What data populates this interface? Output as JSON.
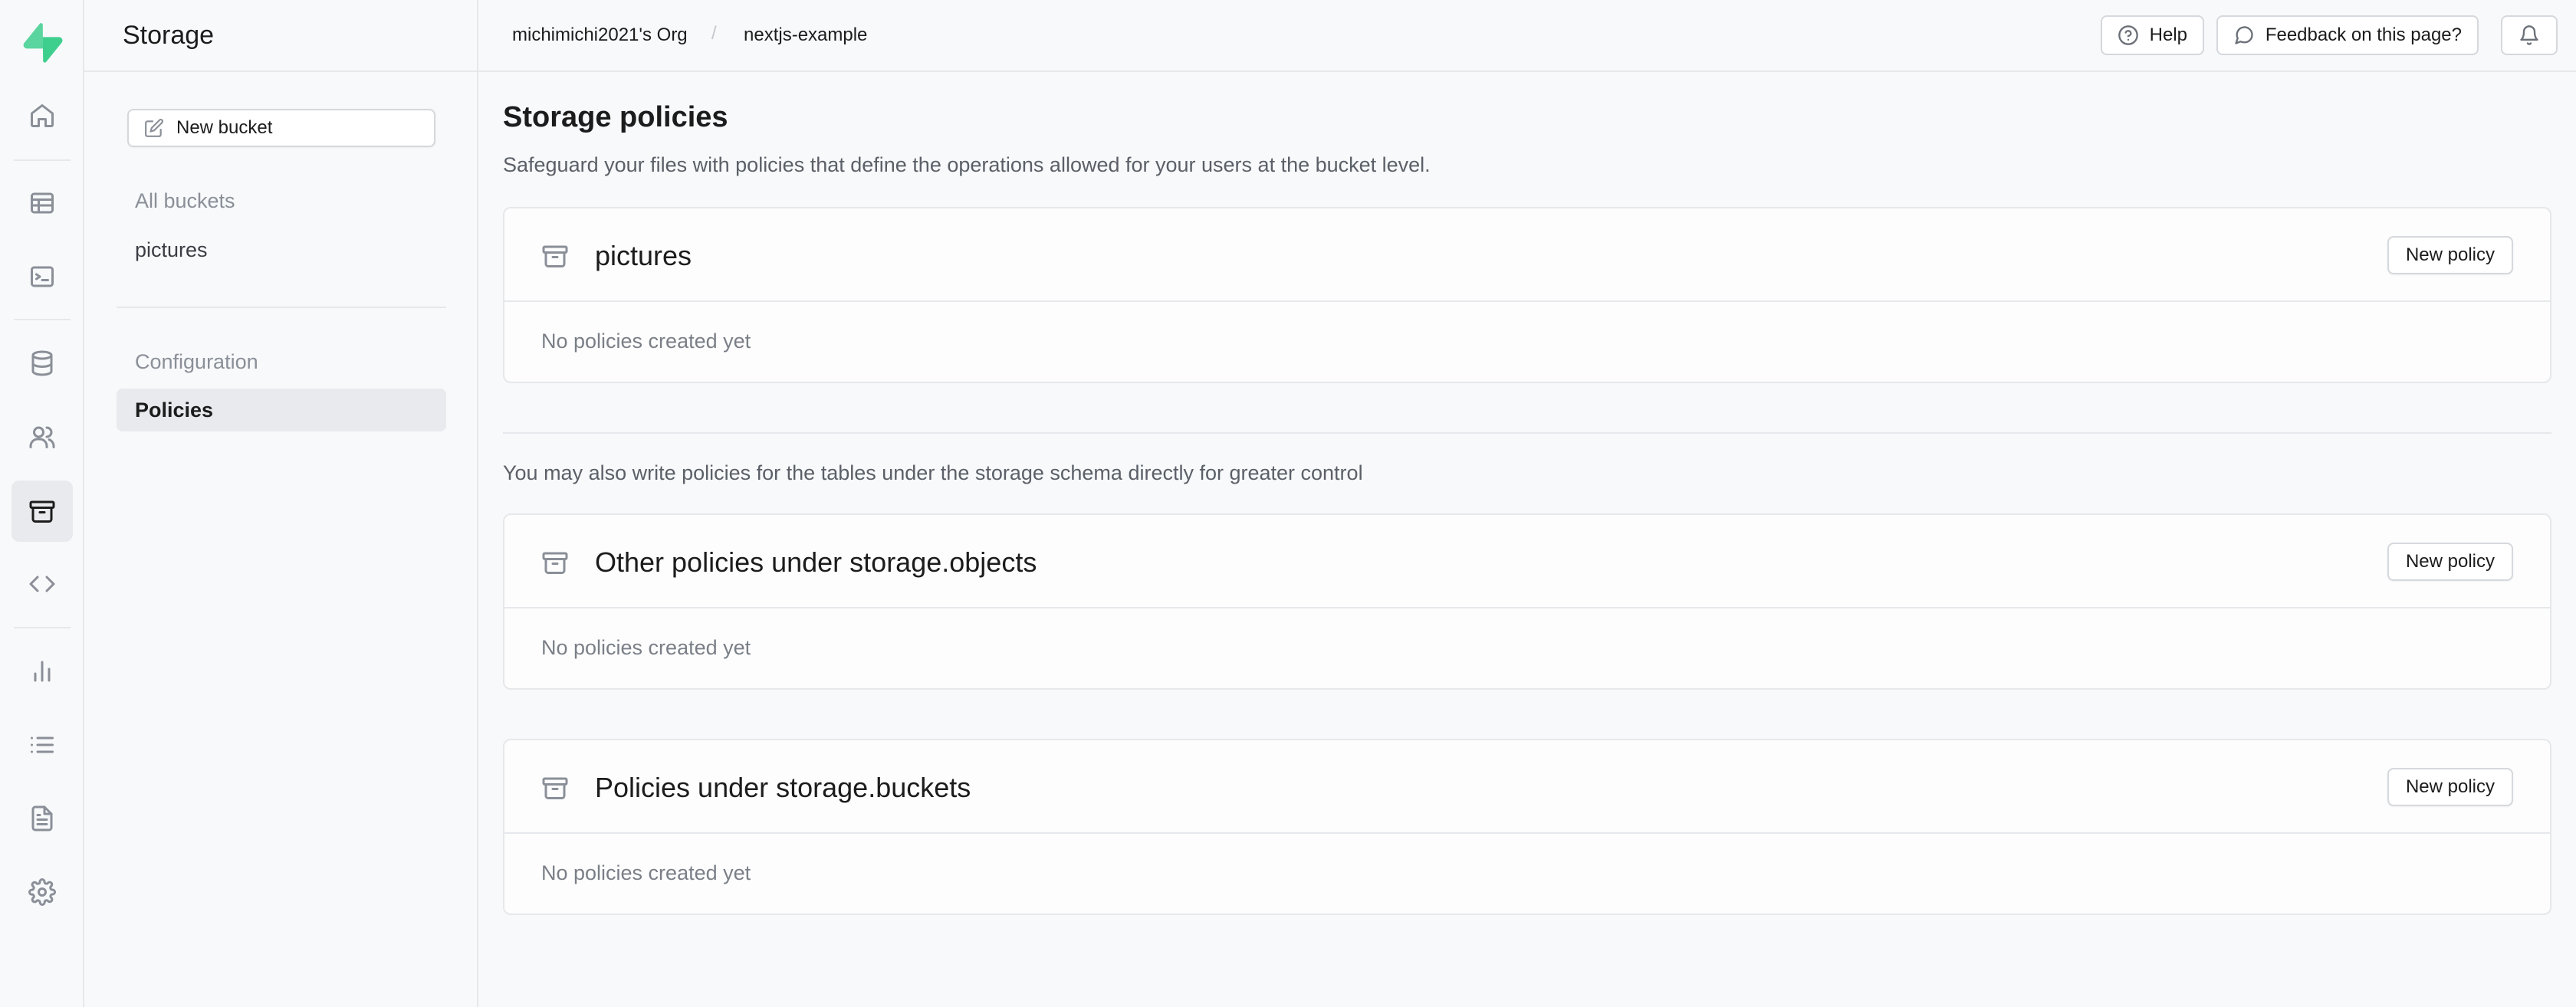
{
  "rail": {
    "logo": "supabase-logo",
    "items": [
      {
        "name": "home",
        "icon": "home-icon"
      },
      {
        "name": "table-editor",
        "icon": "table-icon"
      },
      {
        "name": "sql-editor",
        "icon": "terminal-icon"
      },
      {
        "name": "database",
        "icon": "database-icon"
      },
      {
        "name": "authentication",
        "icon": "users-icon"
      },
      {
        "name": "storage",
        "icon": "archive-icon",
        "active": true
      },
      {
        "name": "edge-functions",
        "icon": "code-icon"
      },
      {
        "name": "reports",
        "icon": "bar-chart-icon"
      },
      {
        "name": "logs",
        "icon": "list-icon"
      },
      {
        "name": "api-docs",
        "icon": "document-icon"
      },
      {
        "name": "settings",
        "icon": "gear-icon"
      }
    ]
  },
  "menu": {
    "title": "Storage",
    "new_bucket_label": "New bucket",
    "buckets": [
      "All buckets",
      "pictures"
    ],
    "section_label": "Configuration",
    "config_items": [
      "Policies"
    ]
  },
  "topbar": {
    "org": "michimichi2021's Org",
    "separator": "/",
    "project": "nextjs-example",
    "help_label": "Help",
    "feedback_label": "Feedback on this page?"
  },
  "main": {
    "title": "Storage policies",
    "subtitle": "Safeguard your files with policies that define the operations allowed for your users at the bucket level.",
    "note": "You may also write policies for the tables under the storage schema directly for greater control",
    "panels": [
      {
        "title": "pictures",
        "button": "New policy",
        "empty": "No policies created yet"
      },
      {
        "title": "Other policies under storage.objects",
        "button": "New policy",
        "empty": "No policies created yet"
      },
      {
        "title": "Policies under storage.buckets",
        "button": "New policy",
        "empty": "No policies created yet"
      }
    ]
  },
  "colors": {
    "brand": "#3ecf8e",
    "background": "#f8f9fa",
    "border": "#e6e8eb"
  }
}
